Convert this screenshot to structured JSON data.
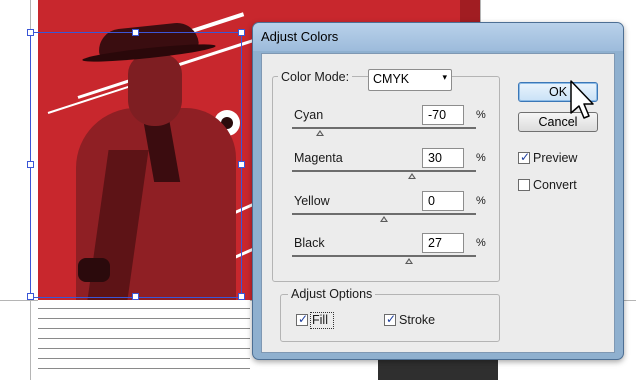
{
  "background": {
    "poster_colors": {
      "red": "#c8272d",
      "dark": "#3a0d10"
    },
    "selection_color": "#3a56d6"
  },
  "dialog": {
    "title": "Adjust Colors",
    "color_mode": {
      "label": "Color Mode:",
      "value": "CMYK",
      "arrow": "▾"
    },
    "channels": [
      {
        "label": "Cyan",
        "value": "-70",
        "unit": "%",
        "level_percent": -70
      },
      {
        "label": "Magenta",
        "value": "30",
        "unit": "%",
        "level_percent": 30
      },
      {
        "label": "Yellow",
        "value": "0",
        "unit": "%",
        "level_percent": 0
      },
      {
        "label": "Black",
        "value": "27",
        "unit": "%",
        "level_percent": 27
      }
    ],
    "buttons": {
      "ok": "OK",
      "cancel": "Cancel"
    },
    "options": {
      "preview": {
        "label": "Preview",
        "checked": true
      },
      "convert": {
        "label": "Convert",
        "checked": false
      }
    },
    "adjust_options": {
      "legend": "Adjust Options",
      "fill": {
        "label": "Fill",
        "checked": true
      },
      "stroke": {
        "label": "Stroke",
        "checked": true
      }
    },
    "check_glyph": "✓"
  },
  "icons": {
    "cursor": "arrow-pointer-icon",
    "dropdown": "chevron-down-icon"
  }
}
